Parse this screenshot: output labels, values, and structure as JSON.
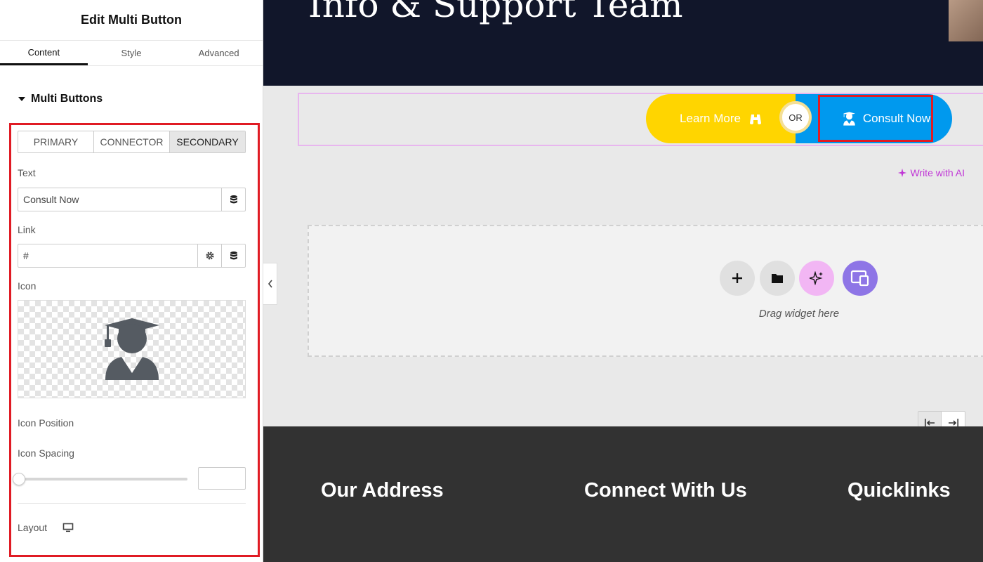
{
  "panel": {
    "title": "Edit Multi Button",
    "tabs": [
      {
        "label": "Content",
        "active": true
      },
      {
        "label": "Style",
        "active": false
      },
      {
        "label": "Advanced",
        "active": false
      }
    ],
    "section_title": "Multi Buttons",
    "segments": [
      {
        "label": "PRIMARY",
        "active": false
      },
      {
        "label": "CONNECTOR",
        "active": false
      },
      {
        "label": "SECONDARY",
        "active": true
      }
    ],
    "text_label": "Text",
    "ai_link": "Write with AI",
    "text_value": "Consult Now",
    "link_label": "Link",
    "link_value": "#",
    "icon_label": "Icon",
    "icon_name": "user-graduate-icon",
    "icon_position_label": "Icon Position",
    "icon_spacing_label": "Icon Spacing",
    "layout_label": "Layout",
    "colors": {
      "accent": "#c036d6",
      "highlight": "#e01b24"
    }
  },
  "canvas": {
    "hero_title": "Info & Support Team",
    "multi_button": {
      "primary_label": "Learn More",
      "primary_icon": "binoculars-icon",
      "connector": "OR",
      "secondary_label": "Consult Now",
      "secondary_icon": "user-graduate-icon",
      "primary_color": "#ffd500",
      "secondary_color": "#0099ee"
    },
    "drop_zone_text": "Drag widget here",
    "footer": {
      "col1": "Our Address",
      "col2": "Connect With Us",
      "col3": "Quicklinks"
    }
  }
}
